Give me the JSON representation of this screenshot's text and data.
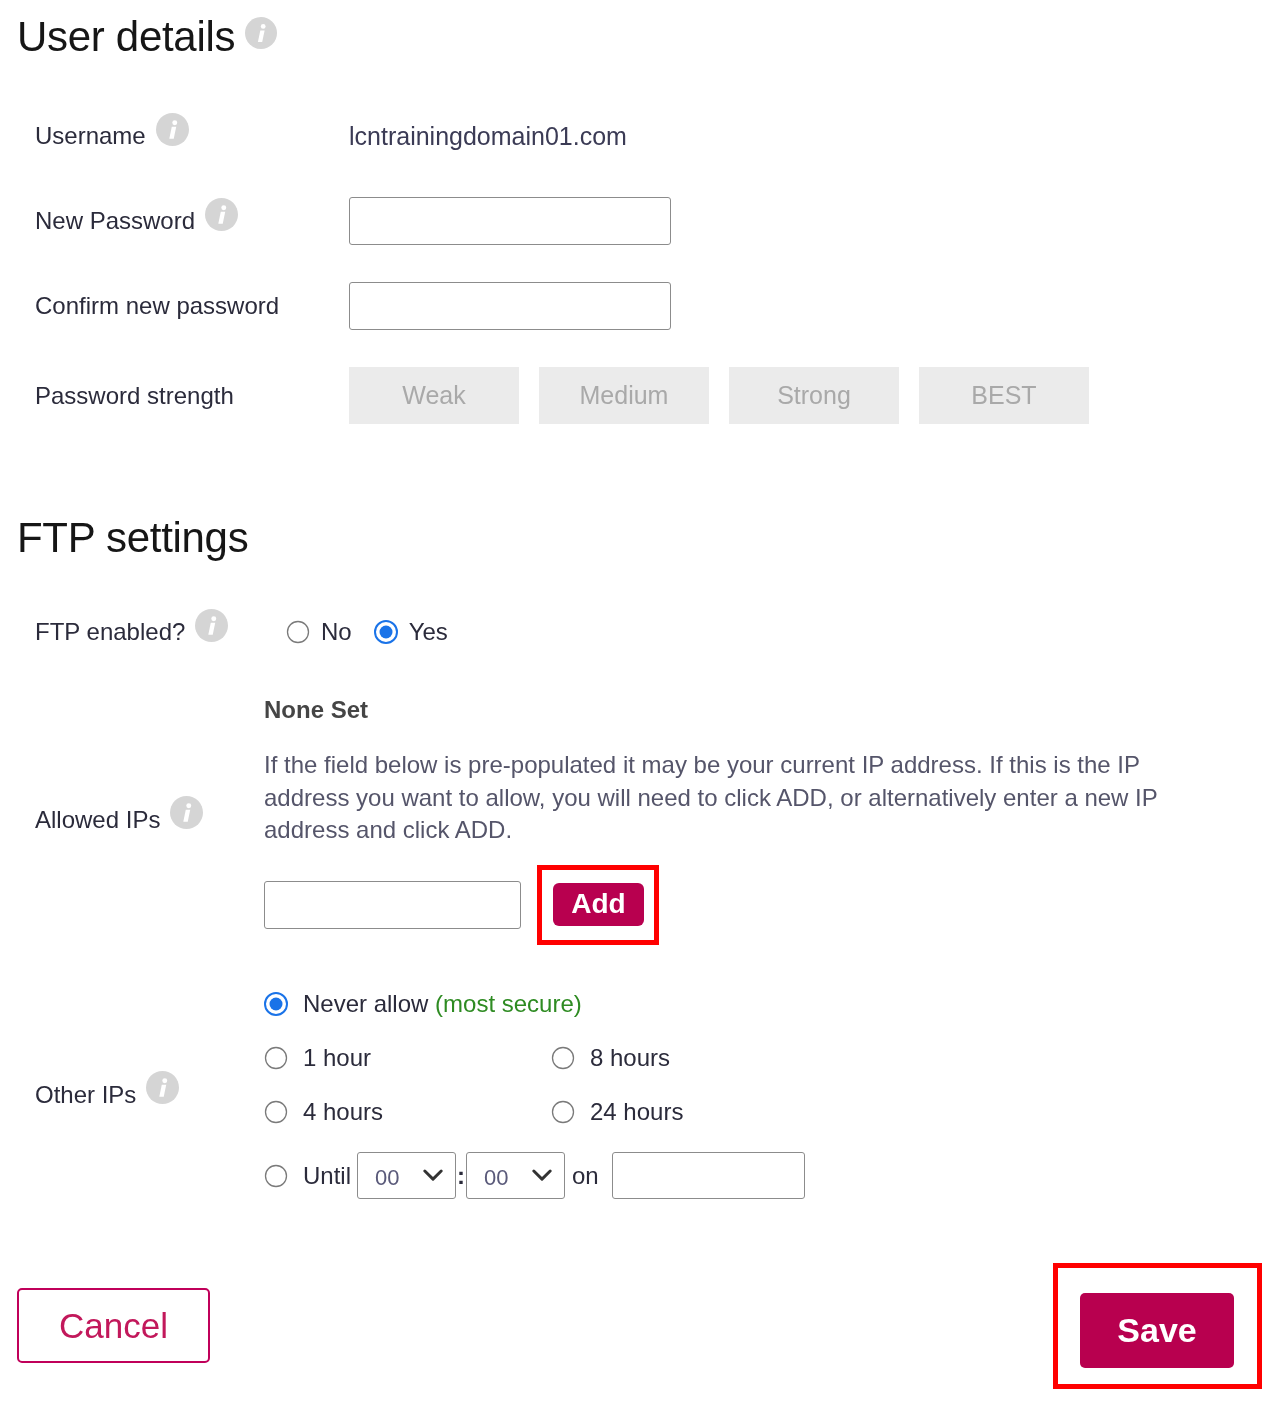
{
  "user_details": {
    "title": "User details",
    "info": true,
    "rows": [
      {
        "kind": "text",
        "label": "Username",
        "info": true,
        "value": "lcntrainingdomain01.com"
      },
      {
        "kind": "password",
        "label": "New Password",
        "info": true
      },
      {
        "kind": "password",
        "label": "Confirm new password",
        "info": false
      },
      {
        "kind": "strength",
        "label": "Password strength",
        "info": false,
        "levels": [
          {
            "label": "Weak",
            "active": false
          },
          {
            "label": "Medium",
            "active": false
          },
          {
            "label": "Strong",
            "active": false
          },
          {
            "label": "BEST",
            "active": false
          }
        ]
      }
    ]
  },
  "ftp_settings": {
    "title": "FTP settings",
    "info": false,
    "ftp_enabled": {
      "label": "FTP enabled?",
      "info": true,
      "options": [
        {
          "label": "No",
          "selected": false
        },
        {
          "label": "Yes",
          "selected": true
        }
      ]
    },
    "allowed_ips": {
      "label": "Allowed IPs",
      "info": true,
      "status": "None Set",
      "help": "If the field below is pre-populated it may be your current IP address. If this is the IP address you want to allow, you will need to click ADD, or alternatively enter a new IP address and click ADD.",
      "add_button": {
        "label": "Add",
        "highlighted": true
      }
    },
    "other_ips": {
      "label": "Other IPs",
      "info": true,
      "options": [
        {
          "kind": "wide",
          "label": "Never allow",
          "note": "(most secure)",
          "selected": true
        },
        {
          "kind": "half",
          "label": "1 hour",
          "selected": false
        },
        {
          "kind": "half",
          "label": "8 hours",
          "selected": false
        },
        {
          "kind": "half",
          "label": "4 hours",
          "selected": false
        },
        {
          "kind": "half",
          "label": "24 hours",
          "selected": false
        },
        {
          "kind": "until",
          "label": "Until",
          "selected": false,
          "hour": "00",
          "separator": ":",
          "minute": "00",
          "on_label": "on"
        }
      ]
    }
  },
  "buttons": [
    {
      "kind": "secondary",
      "label": "Cancel",
      "highlighted": false
    },
    {
      "kind": "primary",
      "label": "Save",
      "highlighted": true
    }
  ]
}
